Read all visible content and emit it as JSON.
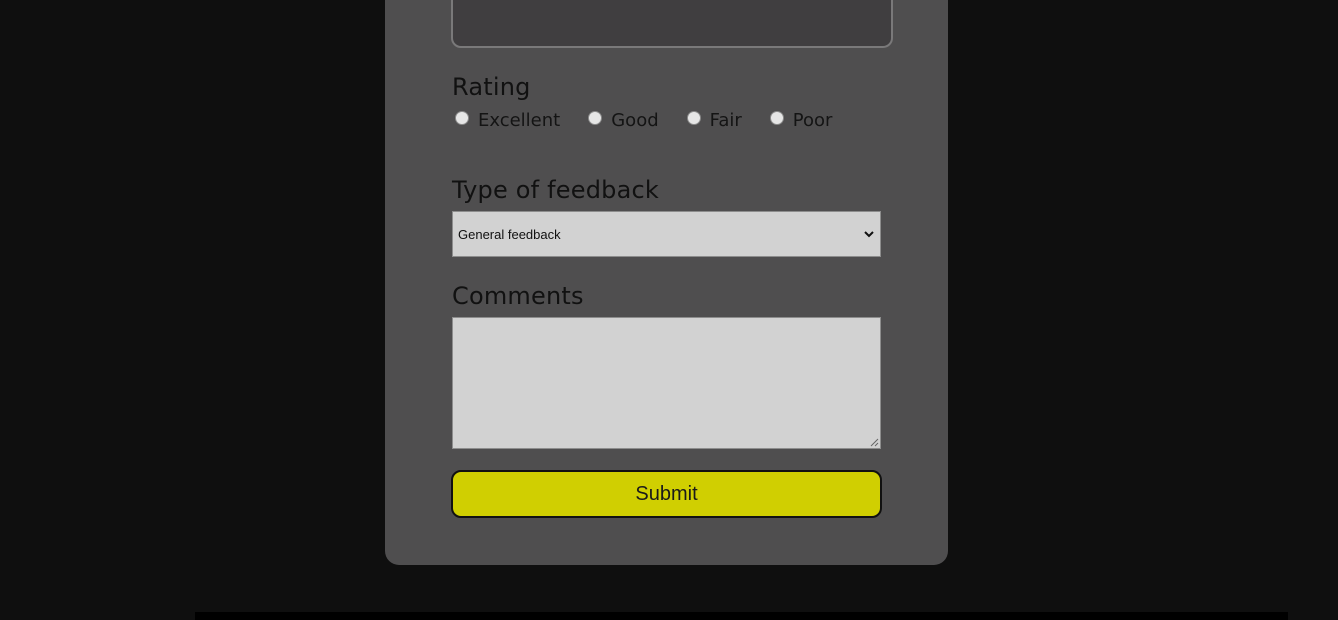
{
  "form": {
    "rating": {
      "label": "Rating",
      "options": [
        "Excellent",
        "Good",
        "Fair",
        "Poor"
      ]
    },
    "feedback_type": {
      "label": "Type of feedback",
      "selected": "General feedback"
    },
    "comments": {
      "label": "Comments",
      "value": ""
    },
    "submit_label": "Submit"
  },
  "colors": {
    "page_bg": "#0f0f0f",
    "card_bg": "#4f4e4f",
    "field_bg": "#d2d2d2",
    "accent": "#d0cf01"
  }
}
